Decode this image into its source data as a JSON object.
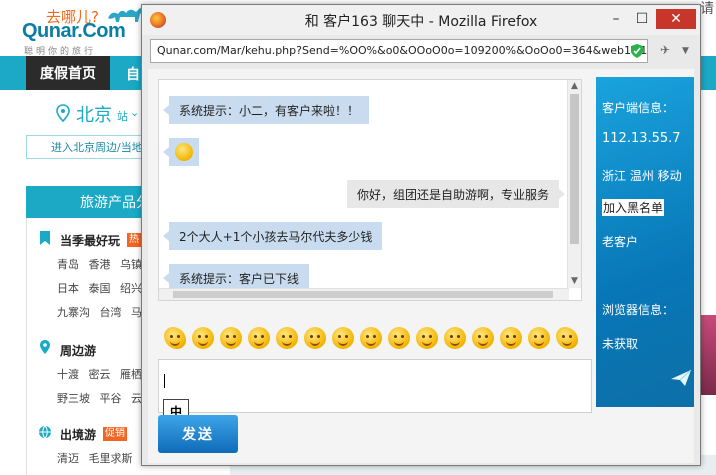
{
  "background_page": {
    "logo_top": "去哪儿?",
    "logo_main": "Qunar.Com",
    "logo_sub": "聪明你的旅行",
    "corner_glyph": "请",
    "nav_active": "度假首页",
    "nav_next": "自",
    "city": "北京",
    "city_suffix": "站",
    "enter_link": "进入北京周边/当地游",
    "category_header": "旅游产品分",
    "sections": [
      {
        "title": "当季最好玩",
        "badge": "热",
        "rows": [
          "青岛 香港 乌镇",
          "日本 泰国 绍兴",
          "九寨沟 台湾 马"
        ]
      },
      {
        "title": "周边游",
        "badge": "",
        "rows": [
          "十渡 密云 雁栖",
          "野三坡 平谷 云"
        ]
      },
      {
        "title": "出境游",
        "badge": "促销",
        "rows": [
          "清迈 毛里求斯"
        ]
      }
    ],
    "accent_color": "#1ba9c6"
  },
  "window": {
    "title": "和   客户163   聊天中 - Mozilla Firefox",
    "url": "Qunar.com/Mar/kehu.php?Send=%OO%&o0&OOoO0o=109200%&OoOo0=364&web1=1&",
    "buttons": {
      "minimize": "–",
      "maximize": "☐",
      "close": "✕"
    }
  },
  "chat": {
    "messages": [
      {
        "side": "left",
        "text": "系统提示：小二，有客户来啦！！"
      },
      {
        "side": "left",
        "text": "🙂"
      },
      {
        "side": "right",
        "text": "你好，组团还是自助游啊，专业服务"
      },
      {
        "side": "left",
        "text": "2个大人+1个小孩去马尔代夫多少钱"
      },
      {
        "side": "left",
        "text": "系统提示：客户已下线"
      }
    ],
    "emoji_count": 15,
    "input_value": "",
    "ime_indicator": "中",
    "send_label": "发送"
  },
  "info_panel": {
    "client_info_label": "客户端信息：",
    "ip": "112.13.55.7",
    "location": "浙江 温州 移动",
    "blacklist_link": "加入黑名单",
    "customer_type": "老客户",
    "browser_info_label": "浏览器信息：",
    "browser_value": "未获取"
  }
}
